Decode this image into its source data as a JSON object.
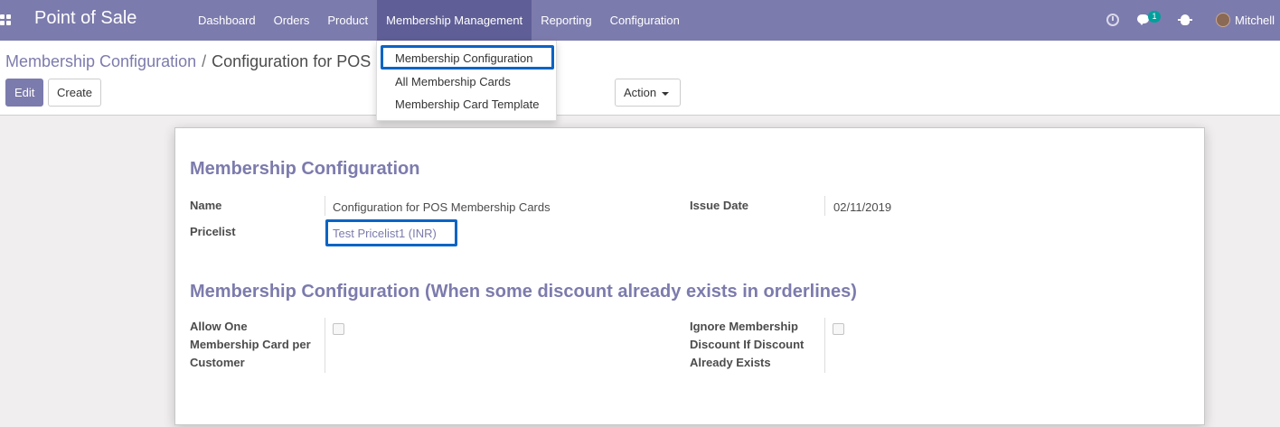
{
  "navbar": {
    "app_title": "Point of Sale",
    "menu": [
      {
        "label": "Dashboard"
      },
      {
        "label": "Orders"
      },
      {
        "label": "Product"
      },
      {
        "label": "Membership Management"
      },
      {
        "label": "Reporting"
      },
      {
        "label": "Configuration"
      }
    ],
    "chat_badge": "1",
    "user_name": "Mitchell",
    "accent_color": "#7c7bad"
  },
  "breadcrumb": {
    "parent": "Membership Configuration",
    "separator": "/",
    "current": "Configuration for POS"
  },
  "buttons": {
    "edit": "Edit",
    "create": "Create",
    "action": "Action"
  },
  "dropdown": {
    "items": [
      {
        "label": "Membership Configuration"
      },
      {
        "label": "All Membership Cards"
      },
      {
        "label": "Membership Card Template"
      }
    ]
  },
  "form": {
    "section1_title": "Membership Configuration",
    "name_label": "Name",
    "name_value": "Configuration for POS Membership Cards",
    "pricelist_label": "Pricelist",
    "pricelist_value": "Test Pricelist1 (INR)",
    "issue_date_label": "Issue Date",
    "issue_date_value": "02/11/2019",
    "section2_title": "Membership Configuration (When some discount already exists in orderlines)",
    "allow_one_label": "Allow One Membership Card per Customer",
    "allow_one_checked": false,
    "ignore_label": "Ignore Membership Discount If Discount Already Exists",
    "ignore_checked": false
  },
  "icons": [
    "apps-icon",
    "clock-icon",
    "chat-icon",
    "bug-icon",
    "avatar"
  ],
  "highlight_color": "#0a64c4"
}
